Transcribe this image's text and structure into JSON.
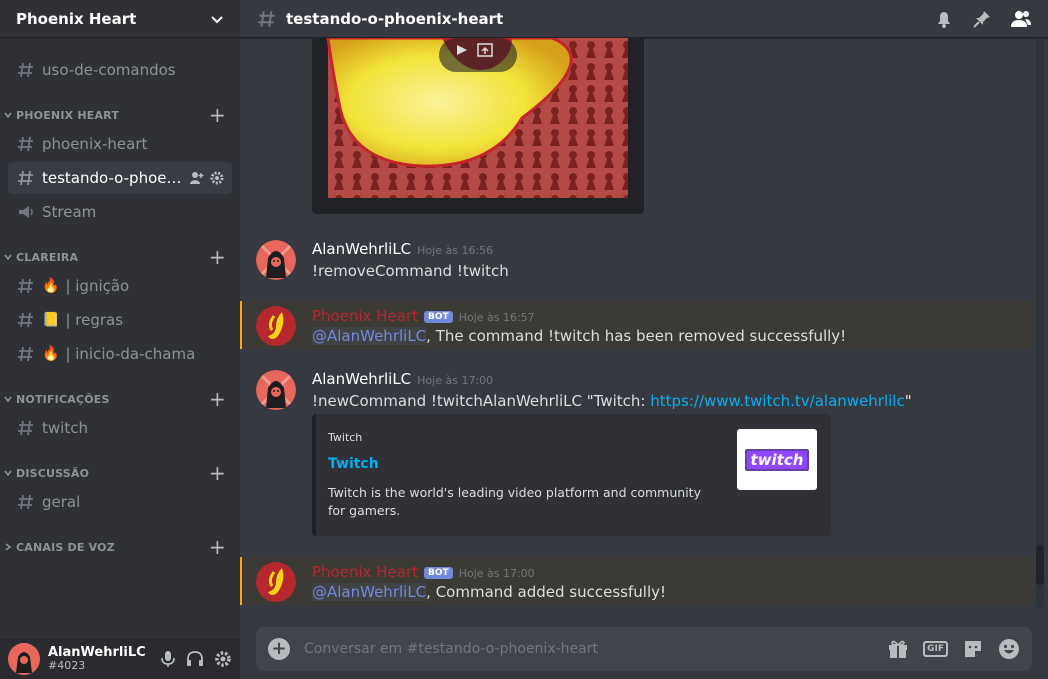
{
  "server": {
    "name": "Phoenix Heart"
  },
  "sidebar": {
    "channels": [
      {
        "label": "uso-de-comandos"
      },
      {
        "label": "phoenix-heart"
      },
      {
        "label": "testando-o-phoeni..."
      },
      {
        "label": "Stream"
      },
      {
        "emoji": "🔥",
        "label": "| ignição"
      },
      {
        "emoji": "📒",
        "label": "| regras"
      },
      {
        "emoji": "🔥",
        "label": "| inicio-da-chama"
      },
      {
        "label": "twitch"
      },
      {
        "label": "geral"
      }
    ],
    "categories": [
      {
        "label": "PHOENIX HEART"
      },
      {
        "label": "CLAREIRA"
      },
      {
        "label": "NOTIFICAÇÕES"
      },
      {
        "label": "DISCUSSÃO"
      },
      {
        "label": "CANAIS DE VOZ"
      }
    ]
  },
  "user": {
    "name": "AlanWehrliLC",
    "tag": "#4023"
  },
  "topbar": {
    "channel": "testando-o-phoenix-heart"
  },
  "messages": [
    {
      "author": "AlanWehrliLC",
      "time": "Hoje às 16:56",
      "text": "!removeCommand !twitch"
    },
    {
      "author": "Phoenix Heart",
      "bot_tag": "BOT",
      "time": "Hoje às 16:57",
      "mention": "@AlanWehrliLC",
      "text": ", The command !twitch has been removed successfully!"
    },
    {
      "author": "AlanWehrliLC",
      "time": "Hoje às 17:00",
      "text": "!newCommand !twitchAlanWehrliLC \"Twitch: ",
      "link": "https://www.twitch.tv/alanwehrlilc",
      "text_end": "\"",
      "embed": {
        "provider": "Twitch",
        "title": "Twitch",
        "description": "Twitch is the world's leading video platform and community for gamers.",
        "thumb_text": "twitch"
      }
    },
    {
      "author": "Phoenix Heart",
      "bot_tag": "BOT",
      "time": "Hoje às 17:00",
      "mention": "@AlanWehrliLC",
      "text": ", Command added successfully!"
    }
  ],
  "composer": {
    "placeholder": "Conversar em #testando-o-phoenix-heart",
    "gif_label": "GIF"
  },
  "colors": {
    "bot_name": "#b6282d",
    "mention": "#7289da",
    "link": "#00b0f4",
    "highlight_border": "#faa61a"
  }
}
